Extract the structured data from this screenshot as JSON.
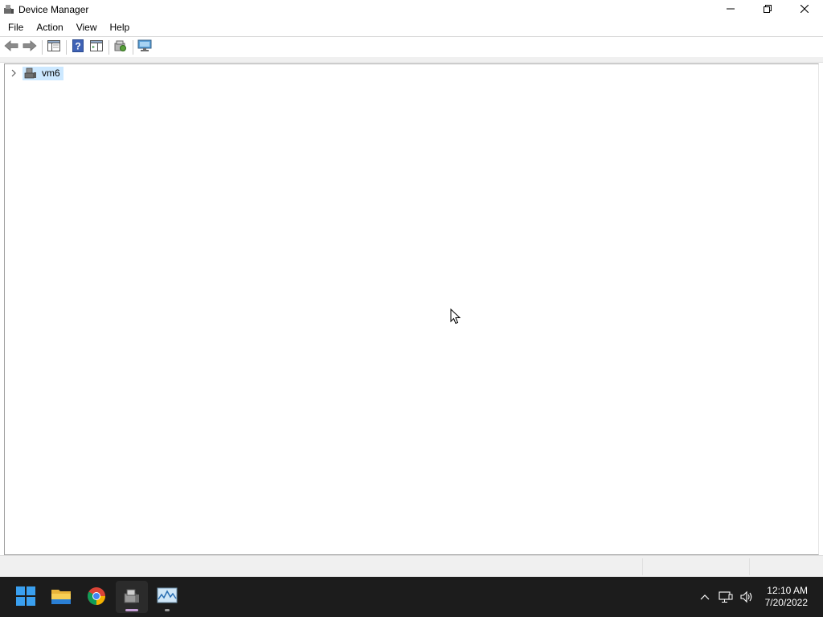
{
  "window": {
    "title": "Device Manager",
    "app_icon": "device-manager-icon",
    "controls": [
      "minimize-icon",
      "restore-icon",
      "close-icon"
    ]
  },
  "menu": {
    "items": [
      {
        "label": "File"
      },
      {
        "label": "Action"
      },
      {
        "label": "View"
      },
      {
        "label": "Help"
      }
    ]
  },
  "toolbar": {
    "buttons": [
      "back-arrow-icon",
      "forward-arrow-icon",
      "show-hide-console-tree-icon",
      "help-icon",
      "show-action-pane-icon",
      "scan-hardware-icon",
      "monitor-icon"
    ]
  },
  "tree": {
    "root": {
      "label": "vm6",
      "icon": "computer-icon",
      "expanded": false,
      "selected": true
    }
  },
  "taskbar": {
    "apps": [
      "start-icon",
      "file-explorer-icon",
      "chrome-icon",
      "device-manager-icon",
      "resource-monitor-icon"
    ],
    "tray": [
      "chevron-up-icon",
      "network-icon",
      "volume-icon"
    ],
    "time": "12:10 AM",
    "date": "7/20/2022"
  },
  "colors": {
    "selection": "#cce8ff",
    "taskbar_bg": "#1c1c1c",
    "accent_indicator": "#c6a0d6"
  }
}
